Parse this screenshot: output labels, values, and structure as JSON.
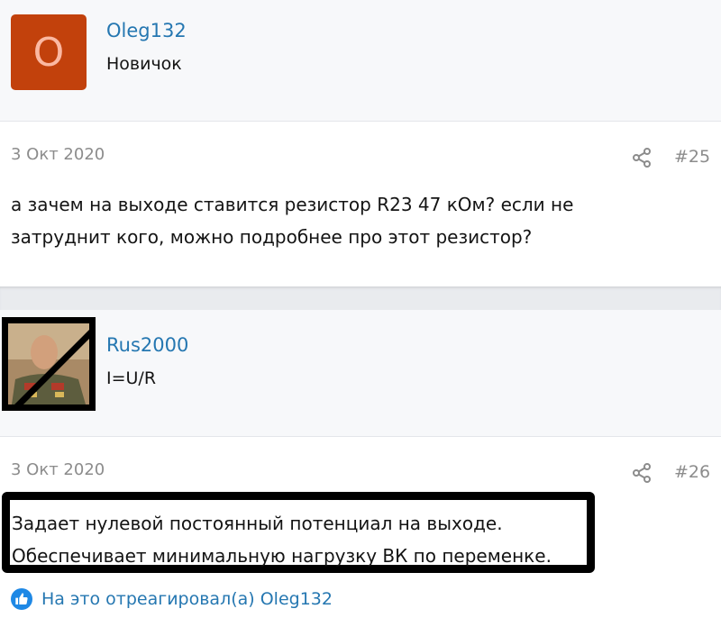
{
  "post1": {
    "author": {
      "avatar_letter": "O",
      "username": "Oleg132",
      "title": "Новичок"
    },
    "date": "3 Окт 2020",
    "number": "#25",
    "message_lines": [
      "а зачем на выходе ставится резистор R23 47 кОм? если не",
      "затруднит кого, можно подробнее про этот резистор?"
    ]
  },
  "post2": {
    "author": {
      "username": "Rus2000",
      "title": "I=U/R"
    },
    "date": "3 Окт 2020",
    "number": "#26",
    "message_lines": [
      "Задает нулевой постоянный потенциал на выходе.",
      "Обеспечивает минимальную нагрузку ВК по переменке."
    ],
    "reaction_text": "На это отреагировал(а) Oleg132"
  },
  "icons": {
    "share": "share-icon",
    "like": "thumbs-up-icon"
  },
  "colors": {
    "link": "#2577b1",
    "avatar_bg": "#c2410c",
    "like_badge": "#1e88e5"
  }
}
